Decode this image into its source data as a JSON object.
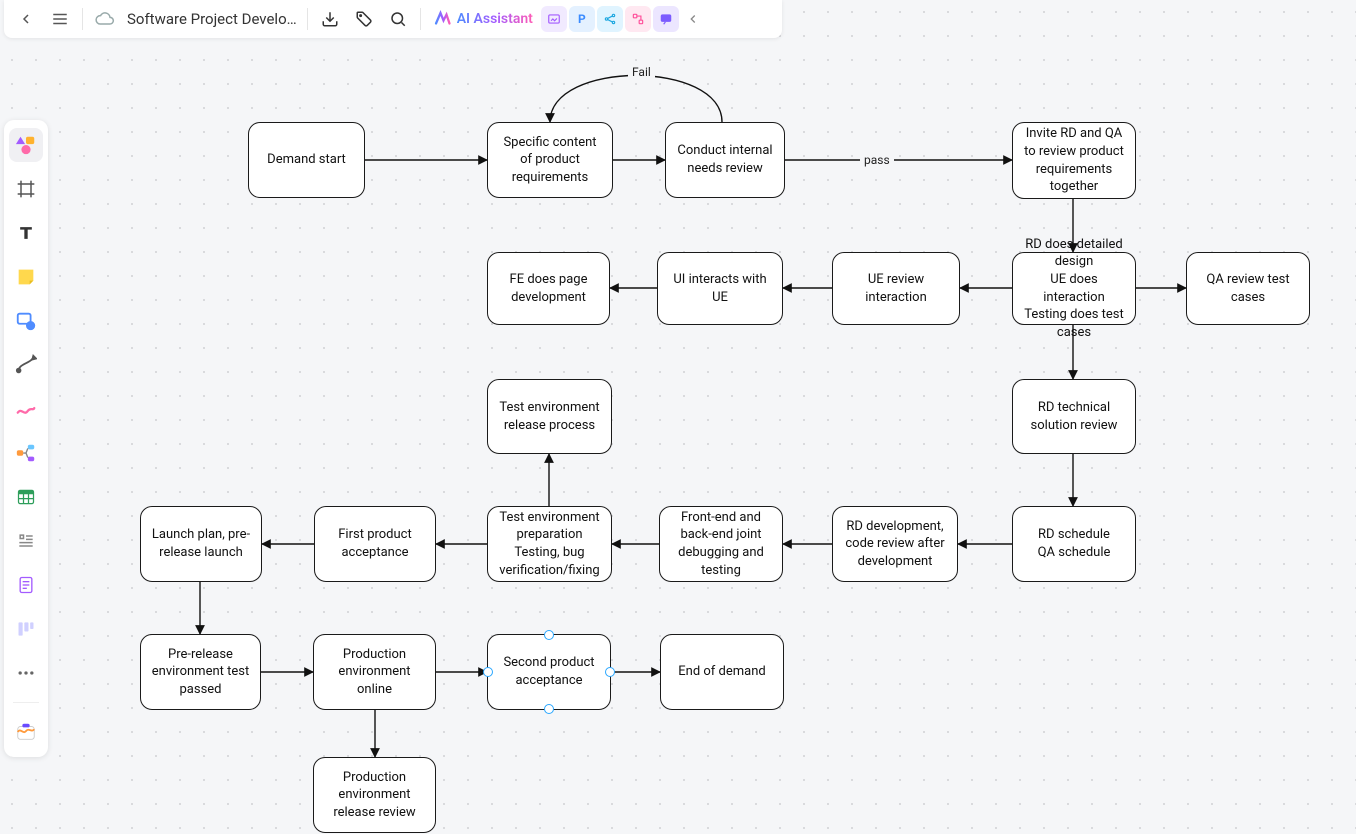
{
  "topbar": {
    "title": "Software Project Develo…",
    "ai_label": "AI Assistant",
    "mini_p": "P"
  },
  "edge_labels": {
    "fail": "Fail",
    "pass": "pass"
  },
  "nodes": {
    "n1": "Demand start",
    "n2": "Specific content of product requirements",
    "n3": "Conduct internal needs review",
    "n4": "Invite RD and QA to review product requirements together",
    "n5": "RD does detailed design\nUE does interaction\nTesting does test cases",
    "n6": "QA review test cases",
    "n7": "UE review interaction",
    "n8": "UI interacts with UE",
    "n9": "FE does page development",
    "n10": "RD technical solution review",
    "n11": "RD schedule\nQA schedule",
    "n12": "RD development, code review after development",
    "n13": "Front-end and back-end joint debugging and testing",
    "n14": "Test environment preparation\nTesting, bug verification/fixing",
    "n15": "Test environment release process",
    "n16": "First product acceptance",
    "n17": "Launch plan, pre-release launch",
    "n18": "Pre-release environment test passed",
    "n19": "Production environment online",
    "n20": "Second product acceptance",
    "n21": "End of demand",
    "n22": "Production environment release review"
  },
  "diagram": {
    "type": "flowchart",
    "node_list": [
      {
        "id": "n1",
        "label": "Demand start"
      },
      {
        "id": "n2",
        "label": "Specific content of product requirements"
      },
      {
        "id": "n3",
        "label": "Conduct internal needs review"
      },
      {
        "id": "n4",
        "label": "Invite RD and QA to review product requirements together"
      },
      {
        "id": "n5",
        "label": "RD does detailed design / UE does interaction / Testing does test cases"
      },
      {
        "id": "n6",
        "label": "QA review test cases"
      },
      {
        "id": "n7",
        "label": "UE review interaction"
      },
      {
        "id": "n8",
        "label": "UI interacts with UE"
      },
      {
        "id": "n9",
        "label": "FE does page development"
      },
      {
        "id": "n10",
        "label": "RD technical solution review"
      },
      {
        "id": "n11",
        "label": "RD schedule / QA schedule"
      },
      {
        "id": "n12",
        "label": "RD development, code review after development"
      },
      {
        "id": "n13",
        "label": "Front-end and back-end joint debugging and testing"
      },
      {
        "id": "n14",
        "label": "Test environment preparation / Testing, bug verification/fixing"
      },
      {
        "id": "n15",
        "label": "Test environment release process"
      },
      {
        "id": "n16",
        "label": "First product acceptance"
      },
      {
        "id": "n17",
        "label": "Launch plan, pre-release launch"
      },
      {
        "id": "n18",
        "label": "Pre-release environment test passed"
      },
      {
        "id": "n19",
        "label": "Production environment online"
      },
      {
        "id": "n20",
        "label": "Second product acceptance"
      },
      {
        "id": "n21",
        "label": "End of demand"
      },
      {
        "id": "n22",
        "label": "Production environment release review"
      }
    ],
    "edges": [
      {
        "from": "n1",
        "to": "n2"
      },
      {
        "from": "n2",
        "to": "n3"
      },
      {
        "from": "n3",
        "to": "n2",
        "label": "Fail"
      },
      {
        "from": "n3",
        "to": "n4",
        "label": "pass"
      },
      {
        "from": "n4",
        "to": "n5"
      },
      {
        "from": "n5",
        "to": "n6"
      },
      {
        "from": "n5",
        "to": "n7"
      },
      {
        "from": "n7",
        "to": "n8"
      },
      {
        "from": "n8",
        "to": "n9"
      },
      {
        "from": "n5",
        "to": "n10"
      },
      {
        "from": "n10",
        "to": "n11"
      },
      {
        "from": "n11",
        "to": "n12"
      },
      {
        "from": "n12",
        "to": "n13"
      },
      {
        "from": "n13",
        "to": "n14"
      },
      {
        "from": "n14",
        "to": "n15"
      },
      {
        "from": "n14",
        "to": "n16"
      },
      {
        "from": "n16",
        "to": "n17"
      },
      {
        "from": "n17",
        "to": "n18"
      },
      {
        "from": "n18",
        "to": "n19"
      },
      {
        "from": "n19",
        "to": "n20"
      },
      {
        "from": "n20",
        "to": "n21"
      },
      {
        "from": "n19",
        "to": "n22"
      }
    ]
  }
}
